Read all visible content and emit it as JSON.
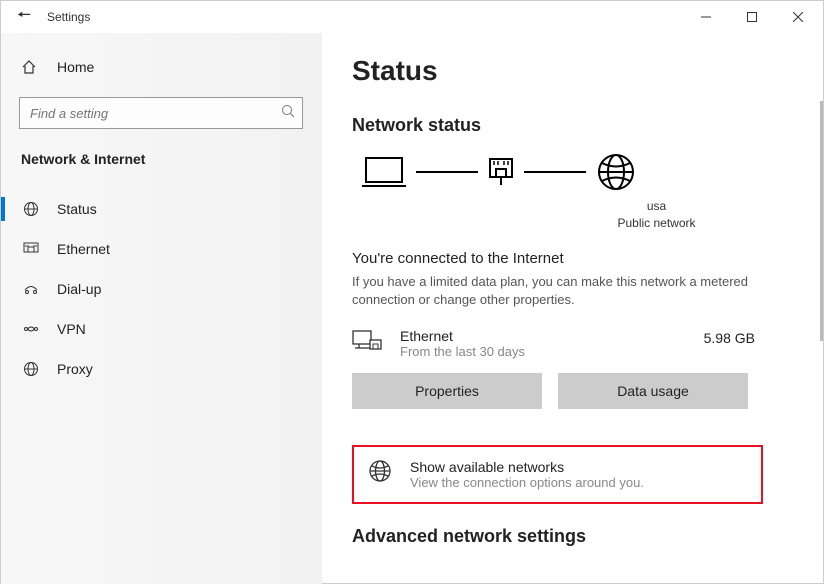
{
  "window": {
    "title": "Settings"
  },
  "sidebar": {
    "home_label": "Home",
    "search_placeholder": "Find a setting",
    "category": "Network & Internet",
    "items": [
      {
        "label": "Status",
        "icon": "globe"
      },
      {
        "label": "Ethernet",
        "icon": "ethernet"
      },
      {
        "label": "Dial-up",
        "icon": "dialup"
      },
      {
        "label": "VPN",
        "icon": "vpn"
      },
      {
        "label": "Proxy",
        "icon": "globe"
      }
    ]
  },
  "main": {
    "title": "Status",
    "network_status_title": "Network status",
    "diagram": {
      "adapter_label": "usa",
      "network_type": "Public network"
    },
    "connected_heading": "You're connected to the Internet",
    "connected_desc": "If you have a limited data plan, you can make this network a metered connection or change other properties.",
    "connection": {
      "name": "Ethernet",
      "period": "From the last 30 days",
      "usage": "5.98 GB"
    },
    "buttons": {
      "properties": "Properties",
      "data_usage": "Data usage"
    },
    "show_networks": {
      "title": "Show available networks",
      "subtitle": "View the connection options around you."
    },
    "advanced_title": "Advanced network settings"
  }
}
